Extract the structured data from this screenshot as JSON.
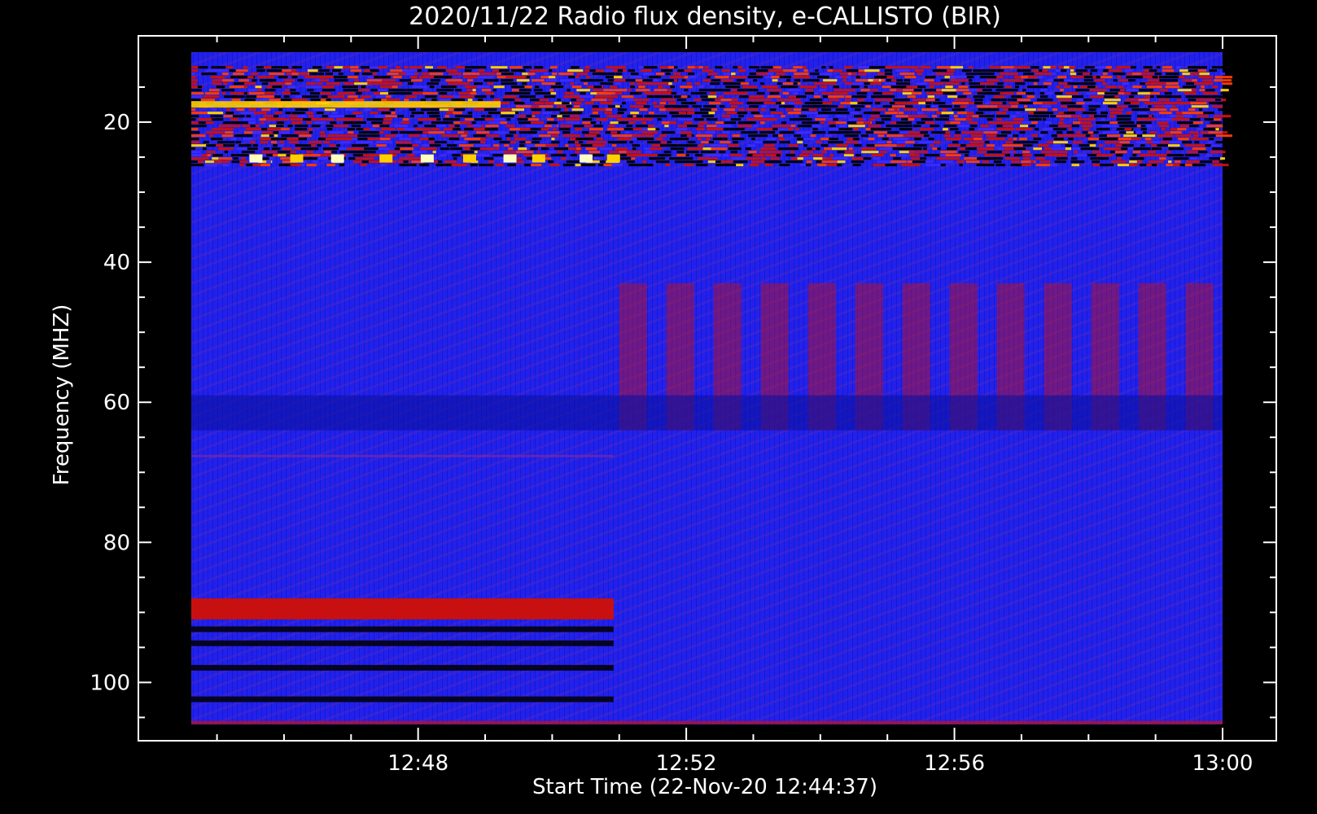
{
  "chart_data": {
    "type": "heatmap",
    "title": "2020/11/22  Radio flux density, e-CALLISTO (BIR)",
    "xlabel": "Start Time (22-Nov-20 12:44:37)",
    "ylabel": "Frequency (MHZ)",
    "x_ticks": [
      "12:48",
      "12:52",
      "12:56",
      "13:00"
    ],
    "y_ticks": [
      "20",
      "40",
      "60",
      "80",
      "100"
    ],
    "x_range": [
      "12:44:37",
      "13:00:00"
    ],
    "y_range": [
      10,
      106
    ],
    "y_inverted": true,
    "colormap": [
      "#000000",
      "#0000c8",
      "#3a2bff",
      "#c81010",
      "#ff3b00",
      "#ffd000",
      "#ffffc0"
    ],
    "background_color": "#1e22f0",
    "features": [
      {
        "desc": "intense bands",
        "freq_mhz": [
          12,
          26
        ],
        "time": [
          "12:44:37",
          "13:00:00"
        ]
      },
      {
        "desc": "periodic vertical bursts",
        "freq_mhz": [
          43,
          64
        ],
        "time": [
          "12:51:00",
          "13:00:00"
        ]
      },
      {
        "desc": "red band",
        "freq_mhz": [
          88,
          91
        ],
        "time": [
          "12:44:37",
          "12:50:55"
        ]
      }
    ]
  }
}
